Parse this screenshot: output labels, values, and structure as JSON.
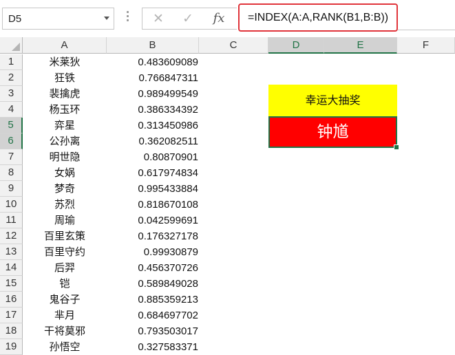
{
  "name_box": {
    "value": "D5"
  },
  "formula_bar": {
    "cancel_glyph": "✕",
    "enter_glyph": "✓",
    "fx_label": "fx",
    "formula": "=INDEX(A:A,RANK(B1,B:B))"
  },
  "columns": [
    "A",
    "B",
    "C",
    "D",
    "E",
    "F"
  ],
  "selected_column": "D",
  "selected_rows": [
    5,
    6
  ],
  "rows": [
    {
      "num": "1",
      "name": "米莱狄",
      "value": "0.483609089"
    },
    {
      "num": "2",
      "name": "狂铁",
      "value": "0.766847311"
    },
    {
      "num": "3",
      "name": "裴擒虎",
      "value": "0.989499549"
    },
    {
      "num": "4",
      "name": "杨玉环",
      "value": "0.386334392"
    },
    {
      "num": "5",
      "name": "弈星",
      "value": "0.313450986"
    },
    {
      "num": "6",
      "name": "公孙离",
      "value": "0.362082511"
    },
    {
      "num": "7",
      "name": "明世隐",
      "value": "0.80870901"
    },
    {
      "num": "8",
      "name": "女娲",
      "value": "0.617974834"
    },
    {
      "num": "9",
      "name": "梦奇",
      "value": "0.995433884"
    },
    {
      "num": "10",
      "name": "苏烈",
      "value": "0.818670108"
    },
    {
      "num": "11",
      "name": "周瑜",
      "value": "0.042599691"
    },
    {
      "num": "12",
      "name": "百里玄策",
      "value": "0.176327178"
    },
    {
      "num": "13",
      "name": "百里守约",
      "value": "0.99930879"
    },
    {
      "num": "14",
      "name": "后羿",
      "value": "0.456370726"
    },
    {
      "num": "15",
      "name": "铠",
      "value": "0.589849028"
    },
    {
      "num": "16",
      "name": "鬼谷子",
      "value": "0.885359213"
    },
    {
      "num": "17",
      "name": "芈月",
      "value": "0.684697702"
    },
    {
      "num": "18",
      "name": "干将莫邪",
      "value": "0.793503017"
    },
    {
      "num": "19",
      "name": "孙悟空",
      "value": "0.327583371"
    }
  ],
  "lottery": {
    "title": "幸运大抽奖",
    "winner": "钟馗",
    "title_color": "#ffff00",
    "winner_color": "#ff0000"
  },
  "colors": {
    "selection": "#217346",
    "formula_highlight": "#e0343a"
  }
}
